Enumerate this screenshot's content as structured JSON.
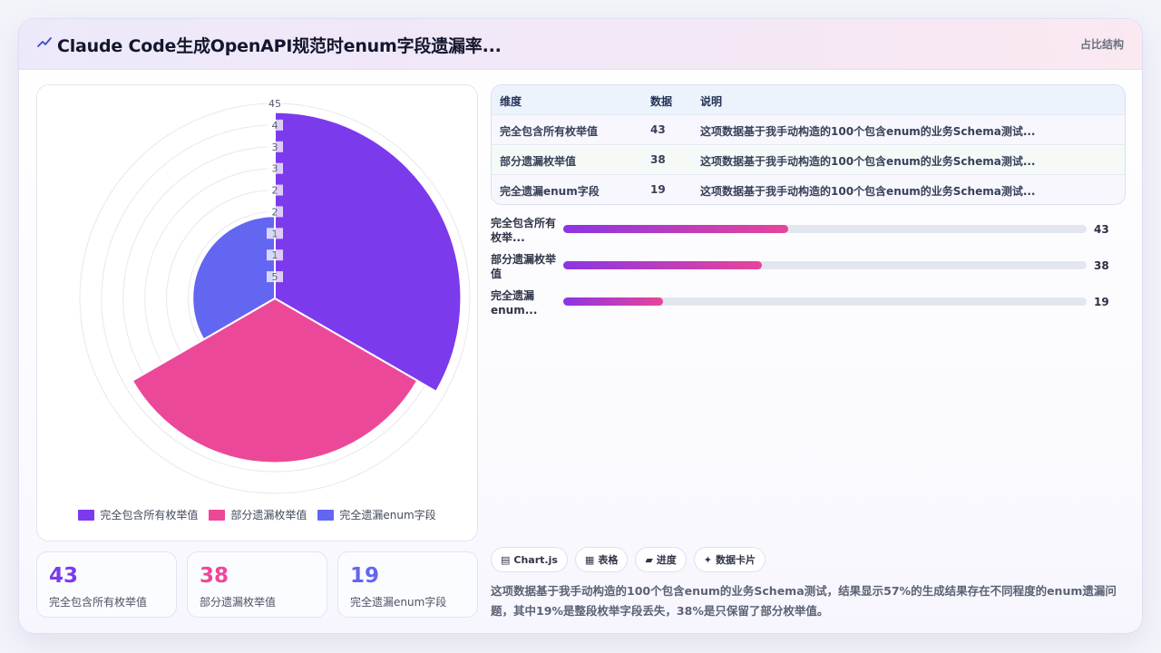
{
  "header": {
    "title": "Claude Code生成OpenAPI规范时enum字段遗漏率...",
    "tag": "占比结构",
    "icon": "chart-line-icon"
  },
  "colors": {
    "purple": "#7c3aed",
    "pink": "#ec4899",
    "indigo": "#6366f1"
  },
  "chart_data": {
    "type": "polarArea",
    "categories": [
      "完全包含所有枚举值",
      "部分遗漏枚举值",
      "完全遗漏enum字段"
    ],
    "values": [
      43,
      38,
      19
    ],
    "colors": [
      "#7c3aed",
      "#ec4899",
      "#6366f1"
    ],
    "r_max": 45,
    "r_ticks": [
      "45",
      "4",
      "3",
      "3",
      "2",
      "2",
      "1",
      "1",
      "5"
    ],
    "legend_position": "bottom",
    "grid": true
  },
  "stats": [
    {
      "value": "43",
      "label": "完全包含所有枚举值",
      "color": "#7c3aed"
    },
    {
      "value": "38",
      "label": "部分遗漏枚举值",
      "color": "#ec4899"
    },
    {
      "value": "19",
      "label": "完全遗漏enum字段",
      "color": "#6366f1"
    }
  ],
  "table": {
    "headers": [
      "维度",
      "数据",
      "说明"
    ],
    "rows": [
      [
        "完全包含所有枚举值",
        "43",
        "这项数据基于我手动构造的100个包含enum的业务Schema测试..."
      ],
      [
        "部分遗漏枚举值",
        "38",
        "这项数据基于我手动构造的100个包含enum的业务Schema测试..."
      ],
      [
        "完全遗漏enum字段",
        "19",
        "这项数据基于我手动构造的100个包含enum的业务Schema测试..."
      ]
    ]
  },
  "progress": [
    {
      "label": "完全包含所有枚举...",
      "value": "43",
      "percent": 43
    },
    {
      "label": "部分遗漏枚举值",
      "value": "38",
      "percent": 38
    },
    {
      "label": "完全遗漏enum...",
      "value": "19",
      "percent": 19
    }
  ],
  "chips": [
    {
      "icon": "chart-icon",
      "glyph": "▤",
      "label": "Chart.js"
    },
    {
      "icon": "table-icon",
      "glyph": "▦",
      "label": "表格"
    },
    {
      "icon": "progress-icon",
      "glyph": "▰",
      "label": "进度"
    },
    {
      "icon": "sparkle-icon",
      "glyph": "✦",
      "label": "数据卡片"
    }
  ],
  "note": "这项数据基于我手动构造的100个包含enum的业务Schema测试，结果显示57%的生成结果存在不同程度的enum遗漏问题，其中19%是整段枚举字段丢失，38%是只保留了部分枚举值。"
}
